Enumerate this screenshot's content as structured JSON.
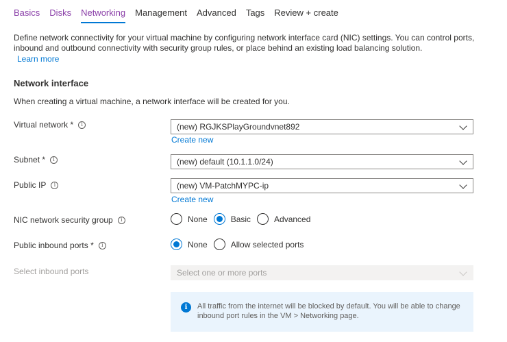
{
  "tabs": [
    {
      "label": "Basics",
      "state": "link"
    },
    {
      "label": "Disks",
      "state": "link"
    },
    {
      "label": "Networking",
      "state": "active"
    },
    {
      "label": "Management",
      "state": "plain"
    },
    {
      "label": "Advanced",
      "state": "plain"
    },
    {
      "label": "Tags",
      "state": "plain"
    },
    {
      "label": "Review + create",
      "state": "plain"
    }
  ],
  "intro": {
    "text": "Define network connectivity for your virtual machine by configuring network interface card (NIC) settings. You can control ports, inbound and outbound connectivity with security group rules, or place behind an existing load balancing solution.",
    "learn_more": "Learn more"
  },
  "network_interface": {
    "title": "Network interface",
    "description": "When creating a virtual machine, a network interface will be created for you."
  },
  "fields": {
    "virtual_network": {
      "label": "Virtual network *",
      "value": "(new) RGJKSPlayGroundvnet892",
      "create_new": "Create new"
    },
    "subnet": {
      "label": "Subnet *",
      "value": "(new) default (10.1.1.0/24)"
    },
    "public_ip": {
      "label": "Public IP",
      "value": "(new) VM-PatchMYPC-ip",
      "create_new": "Create new"
    },
    "nic_nsg": {
      "label": "NIC network security group",
      "options": [
        "None",
        "Basic",
        "Advanced"
      ],
      "selected": "Basic"
    },
    "public_inbound_ports": {
      "label": "Public inbound ports *",
      "options": [
        "None",
        "Allow selected ports"
      ],
      "selected": "None"
    },
    "select_inbound_ports": {
      "label": "Select inbound ports",
      "placeholder": "Select one or more ports"
    }
  },
  "info_message": "All traffic from the internet will be blocked by default. You will be able to change inbound port rules in the VM > Networking page.",
  "icons": {
    "info": "info-icon",
    "chevron": "chevron-down-icon"
  },
  "colors": {
    "accent": "#0078d4",
    "tab_link": "#8a3fa8",
    "info_bg": "#eaf4fd"
  }
}
